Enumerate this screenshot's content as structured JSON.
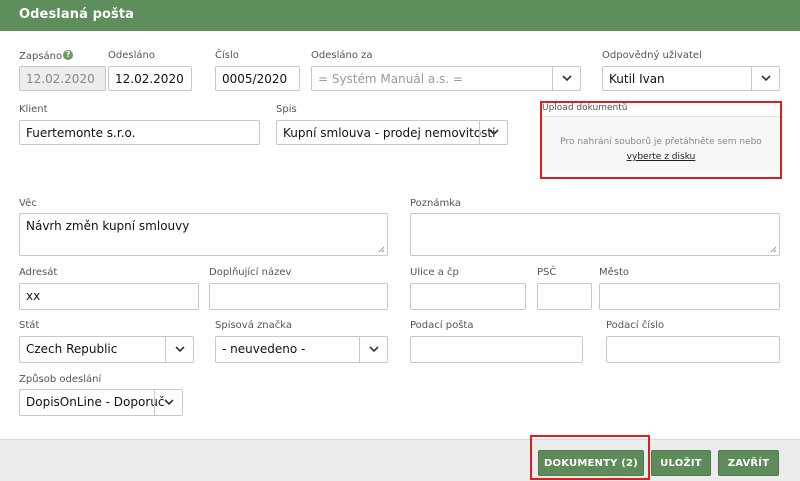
{
  "window": {
    "title": "Odeslaná pošta"
  },
  "fields": {
    "zapsano": {
      "label": "Zapsáno",
      "value": "12.02.2020"
    },
    "odeslano": {
      "label": "Odesláno",
      "value": "12.02.2020"
    },
    "cislo": {
      "label": "Číslo",
      "value": "0005/2020"
    },
    "odeslano_za": {
      "label": "Odesláno za",
      "value": "= Systém Manuál a.s. ="
    },
    "odpovedny": {
      "label": "Odpovědný uživatel",
      "value": "Kutil Ivan"
    },
    "klient": {
      "label": "Klient",
      "value": "Fuertemonte s.r.o."
    },
    "spis": {
      "label": "Spis",
      "value": "Kupní smlouva - prodej nemovitosti"
    },
    "vec": {
      "label": "Věc",
      "value": "Návrh změn kupní smlouvy"
    },
    "poznamka": {
      "label": "Poznámka",
      "value": ""
    },
    "adresat": {
      "label": "Adresát",
      "value": "xx"
    },
    "doplnujici": {
      "label": "Doplňující název",
      "value": ""
    },
    "ulice": {
      "label": "Ulice a čp",
      "value": ""
    },
    "psc": {
      "label": "PSČ",
      "value": ""
    },
    "mesto": {
      "label": "Město",
      "value": ""
    },
    "stat": {
      "label": "Stát",
      "value": "Czech Republic"
    },
    "spisova_znacka": {
      "label": "Spisová značka",
      "value": "- neuvedeno -"
    },
    "podaci_posta": {
      "label": "Podací pošta",
      "value": ""
    },
    "podaci_cislo": {
      "label": "Podací číslo",
      "value": ""
    },
    "zpusob": {
      "label": "Způsob odeslání",
      "value": "DopisOnLine - Doporuč"
    }
  },
  "upload": {
    "label": "Upload dokumentů",
    "hint": "Pro nahrání souborů je přetáhněte sem nebo",
    "link": "vyberte z disku"
  },
  "buttons": {
    "dokumenty": "DOKUMENTY (2)",
    "ulozit": "ULOŽIT",
    "zavrit": "ZAVŘÍT"
  },
  "colors": {
    "accent": "#5e8e5c",
    "highlight": "#e01e1e"
  }
}
